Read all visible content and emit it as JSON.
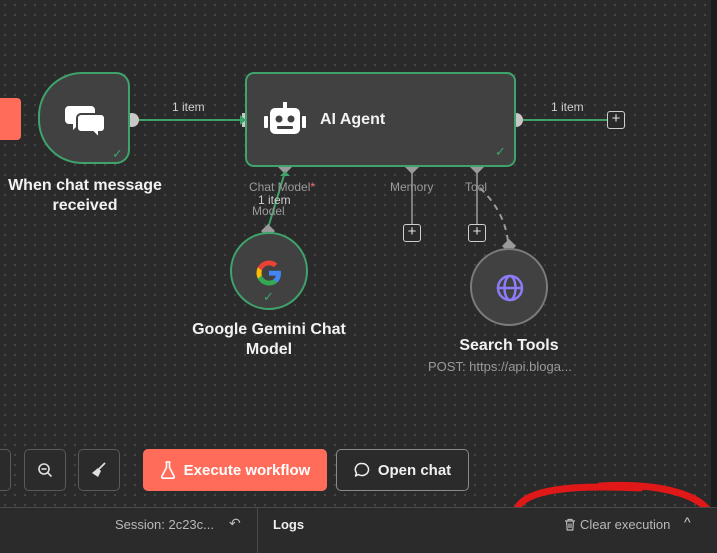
{
  "canvas": {
    "trigger_node": {
      "title": "When chat message received",
      "icon": "chat-bubbles-icon",
      "status": "success"
    },
    "agent_node": {
      "title": "AI Agent",
      "icon": "robot-icon",
      "status": "success"
    },
    "gemini_node": {
      "title": "Google Gemini Chat Model",
      "icon": "google-g-icon",
      "status": "success"
    },
    "search_node": {
      "title": "Search Tools",
      "subtitle": "POST: https://api.bloga...",
      "icon": "globe-icon"
    },
    "connections": {
      "trigger_to_agent_label": "1 item",
      "agent_out_label": "1 item",
      "model_link_label": "1 item"
    },
    "ports": {
      "chat_model": "Chat Model",
      "chat_model_required": "*",
      "memory": "Memory",
      "tool": "Tool",
      "model": "Model"
    },
    "plus_symbol": "+"
  },
  "controls": {
    "zoom_out_icon": "zoom-out-icon",
    "cleanup_icon": "broom-icon",
    "execute_label": "Execute workflow",
    "execute_icon": "flask-icon",
    "open_chat_label": "Open chat",
    "open_chat_icon": "chat-icon"
  },
  "bottom_bar": {
    "session_label": "Session: 2c23c...",
    "logs_label": "Logs",
    "clear_execution_label": "Clear execution",
    "chevron": "^"
  },
  "colors": {
    "accent": "#ff6d5a",
    "success": "#3fa36b",
    "node_bg": "#414141",
    "annotation": "#e01818"
  }
}
